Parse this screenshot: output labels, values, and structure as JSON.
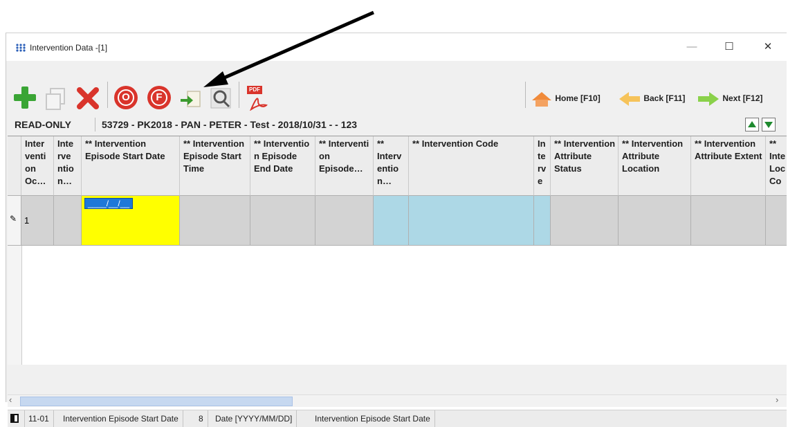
{
  "window": {
    "title": "Intervention Data -[1]",
    "minimize_label": "—",
    "maximize_label": "☐",
    "close_label": "✕"
  },
  "toolbar": {
    "icons": [
      "add-icon",
      "copy-icon",
      "delete-icon",
      "o-icon",
      "f-icon",
      "export-icon",
      "query-icon",
      "pdf-icon"
    ],
    "pdf_label": "PDF",
    "o_label": "O",
    "f_label": "F",
    "home_label": "Home [F10]",
    "back_label": "Back [F11]",
    "next_label": "Next [F12]"
  },
  "info": {
    "mode": "READ-ONLY",
    "record": "53729 - PK2018 - PAN - PETER - Test - 2018/10/31 -  - 123"
  },
  "grid": {
    "columns": [
      {
        "label": "Inter venti on Oc…"
      },
      {
        "label": "Inte rve ntio n…"
      },
      {
        "label": "** Intervention Episode Start Date"
      },
      {
        "label": "** Intervention Episode Start Time"
      },
      {
        "label": "** Interventio n Episode End Date"
      },
      {
        "label": "** Interventi on Episode…"
      },
      {
        "label": "** Interv entio n…"
      },
      {
        "label": "** Intervention Code"
      },
      {
        "label": "In te rv e"
      },
      {
        "label": "** Intervention Attribute Status"
      },
      {
        "label": "** Intervention Attribute Location"
      },
      {
        "label": "** Intervention Attribute Extent"
      },
      {
        "label": "** Inte Loc Co"
      }
    ],
    "rows": [
      {
        "marker": "✎",
        "occurrence": "1",
        "start_date": "____/__/__"
      }
    ]
  },
  "status": {
    "field_code": "11-01",
    "field_name": "Intervention Episode Start Date",
    "length": "8",
    "format": "Date [YYYY/MM/DD]",
    "description": "Intervention Episode Start Date"
  },
  "colors": {
    "required_cell": "#ffff00",
    "code_cell": "#add8e6",
    "readonly_cell": "#d3d3d3",
    "accent_red": "#d9342b"
  }
}
